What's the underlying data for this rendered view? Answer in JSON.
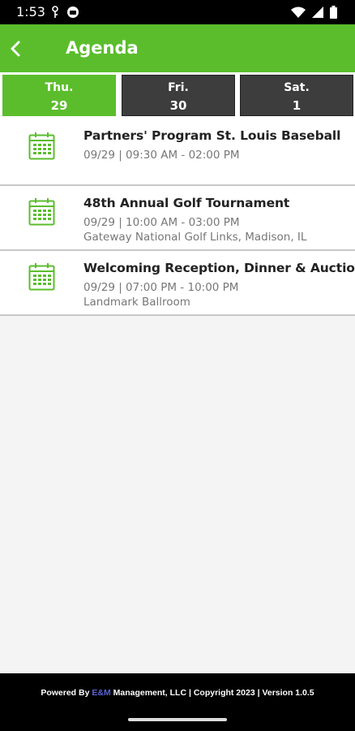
{
  "status_bar": {
    "time": "1:53",
    "left_icons": [
      "vpn-key-icon",
      "media-icon"
    ],
    "right_icons": [
      "wifi-icon",
      "signal-icon",
      "battery-icon"
    ]
  },
  "header": {
    "title": "Agenda",
    "accent_color": "#5bbd2c"
  },
  "days": [
    {
      "name": "Thu.",
      "number": "29",
      "active": true
    },
    {
      "name": "Fri.",
      "number": "30",
      "active": false
    },
    {
      "name": "Sat.",
      "number": "1",
      "active": false
    }
  ],
  "events": [
    {
      "title": "Partners' Program St. Louis Baseball",
      "time": "09/29 | 09:30 AM - 02:00 PM",
      "location": ""
    },
    {
      "title": "48th Annual Golf Tournament",
      "time": "09/29 | 10:00 AM - 03:00 PM",
      "location": "Gateway National Golf Links, Madison, IL"
    },
    {
      "title": "Welcoming Reception, Dinner & Auctions",
      "time": "09/29 | 07:00 PM - 10:00 PM",
      "location": "Landmark Ballroom"
    }
  ],
  "footer": {
    "prefix": "Powered By ",
    "brand": "E&M",
    "suffix": " Management, LLC | Copyright 2023 | Version 1.0.5"
  }
}
